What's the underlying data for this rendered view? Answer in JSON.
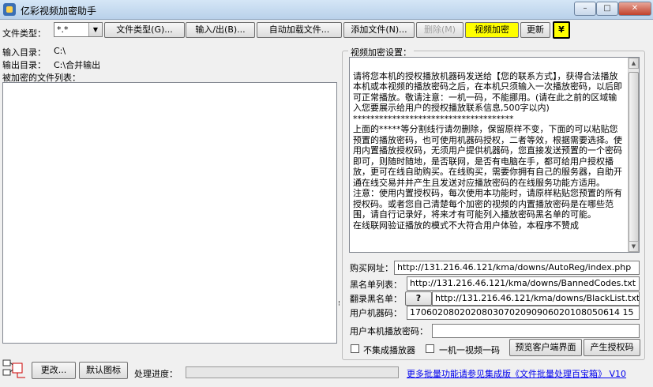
{
  "window": {
    "title": "亿彩视频加密助手",
    "controls": {
      "minimize": "–",
      "maximize": "□",
      "close": "✕"
    }
  },
  "toolbar": {
    "file_type_label": "文件类型：",
    "file_type_value": "*.*",
    "buttons": {
      "file_type": "文件类型(G)...",
      "import_export": "输入/出(B)...",
      "auto_load": "自动加载文件...",
      "add_file": "添加文件(N)...",
      "delete": "删除(M)",
      "video_encrypt": "视频加密",
      "update": "更新",
      "yen": "¥"
    }
  },
  "left": {
    "input_dir_label": "输入目录：",
    "input_dir_value": "C:\\",
    "output_dir_label": "输出目录：",
    "output_dir_value": "C:\\合并输出",
    "file_list_label": "被加密的文件列表："
  },
  "settings": {
    "group_title": "视频加密设置：",
    "description": "请将您本机的授权播放机器码发送给【您的联系方式】，获得合法播放本机或本视频的播放密码之后，在本机只须输入一次播放密码，以后即可正常播放。敬请注意：一机一码，不能挪用。(请在此之前的区域输入您要展示给用户的授权播放联系信息,500字以内)\n*************************************\n上面的*****等分割线行请勿删除，保留原样不变，下面的可以粘贴您预置的播放密码，也可使用机器码授权，二者等效，根据需要选择。使用内置播放授权码，无须用户提供机器码，您直接发送预置的一个密码即可，则随时随地，是否联网，是否有电脑在手，都可给用户授权播放，更可在线自助购买。在线购买，需要你拥有自己的服务器，自助开通在线交易并并产生且发送对应播放密码的在线服务功能方适用。\n注意：使用内置授权码，每次使用本功能时，请原样粘贴您预置的所有授权码。或者您自己清楚每个加密的视频的内置播放密码是在哪些范围，请自行记录好，将来才有可能列入播放密码黑名单的可能。\n在线联网验证播放的模式不大符合用户体验，本程序不赞成",
    "buy_url_label": "购买网址：",
    "buy_url_value": "http://131.216.46.121/kma/downs/AutoReg/index.php",
    "blacklist_label": "黑名单列表：",
    "blacklist_value": "http://131.216.46.121/kma/downs/BannedCodes.txt",
    "flip_blacklist_label": "翻录黑名单：",
    "flip_blacklist_help": "?",
    "flip_blacklist_value": "http://131.216.46.121/kma/downs/BlackList.txt",
    "machine_code_label": "用户机器码：",
    "machine_code_value": "17060208020208030702090906020108050614 15",
    "local_password_label": "用户本机播放密码：",
    "local_password_value": "",
    "no_player_label": "不集成播放器",
    "one_machine_label": "一机一视频一码",
    "preview_button": "预览客户端界面",
    "gen_code_button": "产生授权码"
  },
  "bottom": {
    "change_button": "更改...",
    "default_icon_button": "默认图标",
    "progress_label": "处理进度：",
    "promo_link": "更多批量功能请参见集成版《文件批量处理百宝箱》 V10"
  }
}
